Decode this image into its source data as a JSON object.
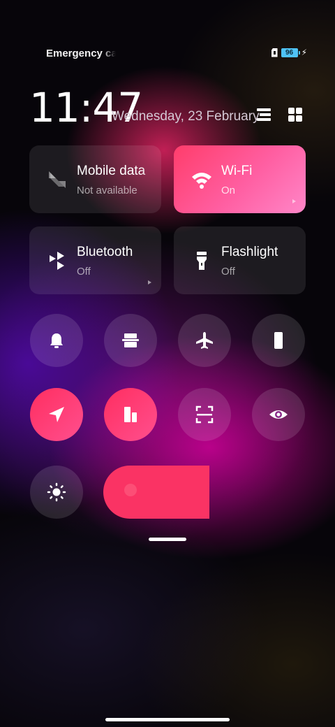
{
  "status_bar": {
    "carrier_text": "Emergency calls only",
    "battery_level": "96",
    "charging": true
  },
  "header": {
    "time": "11:47",
    "date": "Wednesday, 23 February"
  },
  "tiles": [
    {
      "name": "Mobile data",
      "state": "Not available",
      "active": false,
      "icon": "mobile-data-icon"
    },
    {
      "name": "Wi-Fi",
      "state": "On",
      "active": true,
      "icon": "wifi-icon"
    },
    {
      "name": "Bluetooth",
      "state": "Off",
      "active": false,
      "icon": "bluetooth-icon"
    },
    {
      "name": "Flashlight",
      "state": "Off",
      "active": false,
      "icon": "flashlight-icon"
    }
  ],
  "toggles": [
    {
      "icon": "bell-icon",
      "active": false
    },
    {
      "icon": "screenshot-icon",
      "active": false
    },
    {
      "icon": "airplane-icon",
      "active": false
    },
    {
      "icon": "rotate-lock-icon",
      "active": false
    },
    {
      "icon": "location-icon",
      "active": true
    },
    {
      "icon": "reading-mode-icon",
      "active": true
    },
    {
      "icon": "scanner-icon",
      "active": false
    },
    {
      "icon": "eye-icon",
      "active": false
    },
    {
      "icon": "brightness-icon",
      "active": false
    }
  ],
  "brightness": {
    "level_percent": 40
  },
  "colors": {
    "accent": "#fa3364",
    "wifi_tile_start": "#ff3d6b",
    "wifi_tile_end": "#ff86c8",
    "battery": "#4fc3f7"
  }
}
